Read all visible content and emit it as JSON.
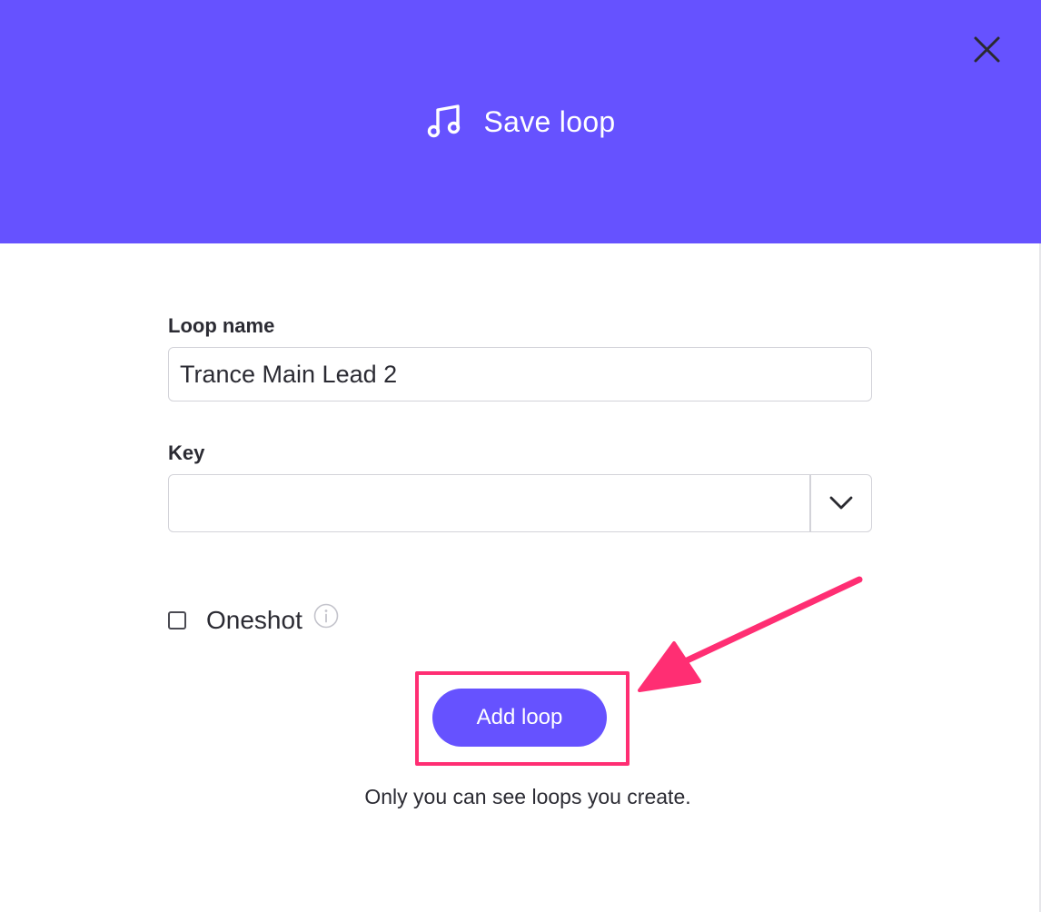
{
  "header": {
    "title": "Save loop",
    "background_color": "#6652ff",
    "icon": "music-note-icon",
    "close_icon": "close-icon"
  },
  "form": {
    "loop_name_label": "Loop name",
    "loop_name_value": "Trance Main Lead 2",
    "key_label": "Key",
    "key_value": "",
    "key_chevron_icon": "chevron-down-icon",
    "oneshot_label": "Oneshot",
    "oneshot_checked": false,
    "oneshot_info_icon": "info-icon"
  },
  "actions": {
    "add_loop_label": "Add loop",
    "button_color": "#6652ff"
  },
  "footer": {
    "note": "Only you can see loops you create."
  },
  "annotation": {
    "highlight_color": "#ff2e73",
    "arrow_icon": "arrow-icon"
  }
}
